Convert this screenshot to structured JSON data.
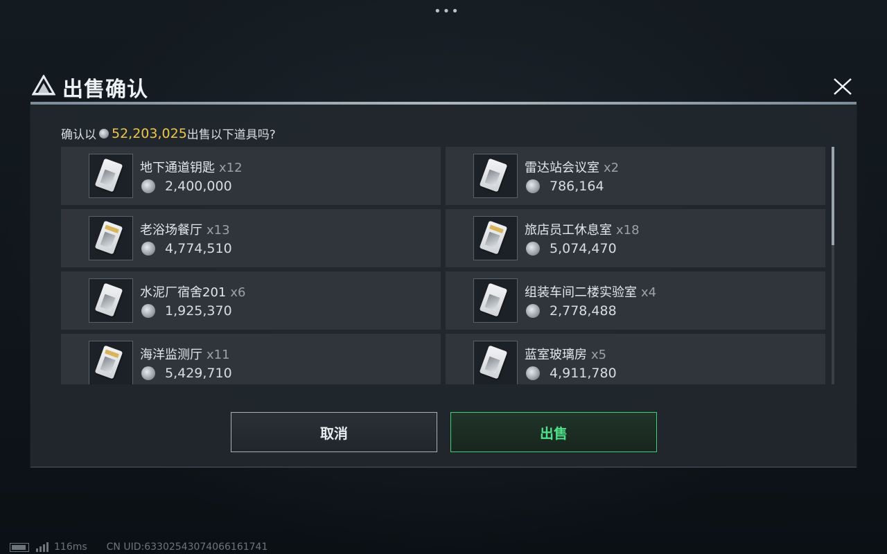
{
  "dialog": {
    "title": "出售确认",
    "confirm_prefix": "确认以",
    "total_amount": "52,203,025",
    "confirm_suffix": "出售以下道具吗?"
  },
  "items": [
    {
      "name": "地下通道钥匙",
      "qty": "x12",
      "price": "2,400,000"
    },
    {
      "name": "雷达站会议室",
      "qty": "x2",
      "price": "786,164"
    },
    {
      "name": "老浴场餐厅",
      "qty": "x13",
      "price": "4,774,510"
    },
    {
      "name": "旅店员工休息室",
      "qty": "x18",
      "price": "5,074,470"
    },
    {
      "name": "水泥厂宿舍201",
      "qty": "x6",
      "price": "1,925,370"
    },
    {
      "name": "组装车间二楼实验室",
      "qty": "x4",
      "price": "2,778,488"
    },
    {
      "name": "海洋监测厅",
      "qty": "x11",
      "price": "5,429,710"
    },
    {
      "name": "蓝室玻璃房",
      "qty": "x5",
      "price": "4,911,780"
    }
  ],
  "buttons": {
    "cancel": "取消",
    "sell": "出售"
  },
  "status": {
    "ping": "116ms",
    "uid": "CN UID:6330254307406616174​1"
  },
  "colors": {
    "amount": "#f0c64a",
    "sell_accent": "#3fd27a"
  },
  "icons": {
    "menu": "more-dots-icon",
    "close": "close-icon",
    "logo": "game-logo-icon",
    "currency": "coin-icon"
  }
}
